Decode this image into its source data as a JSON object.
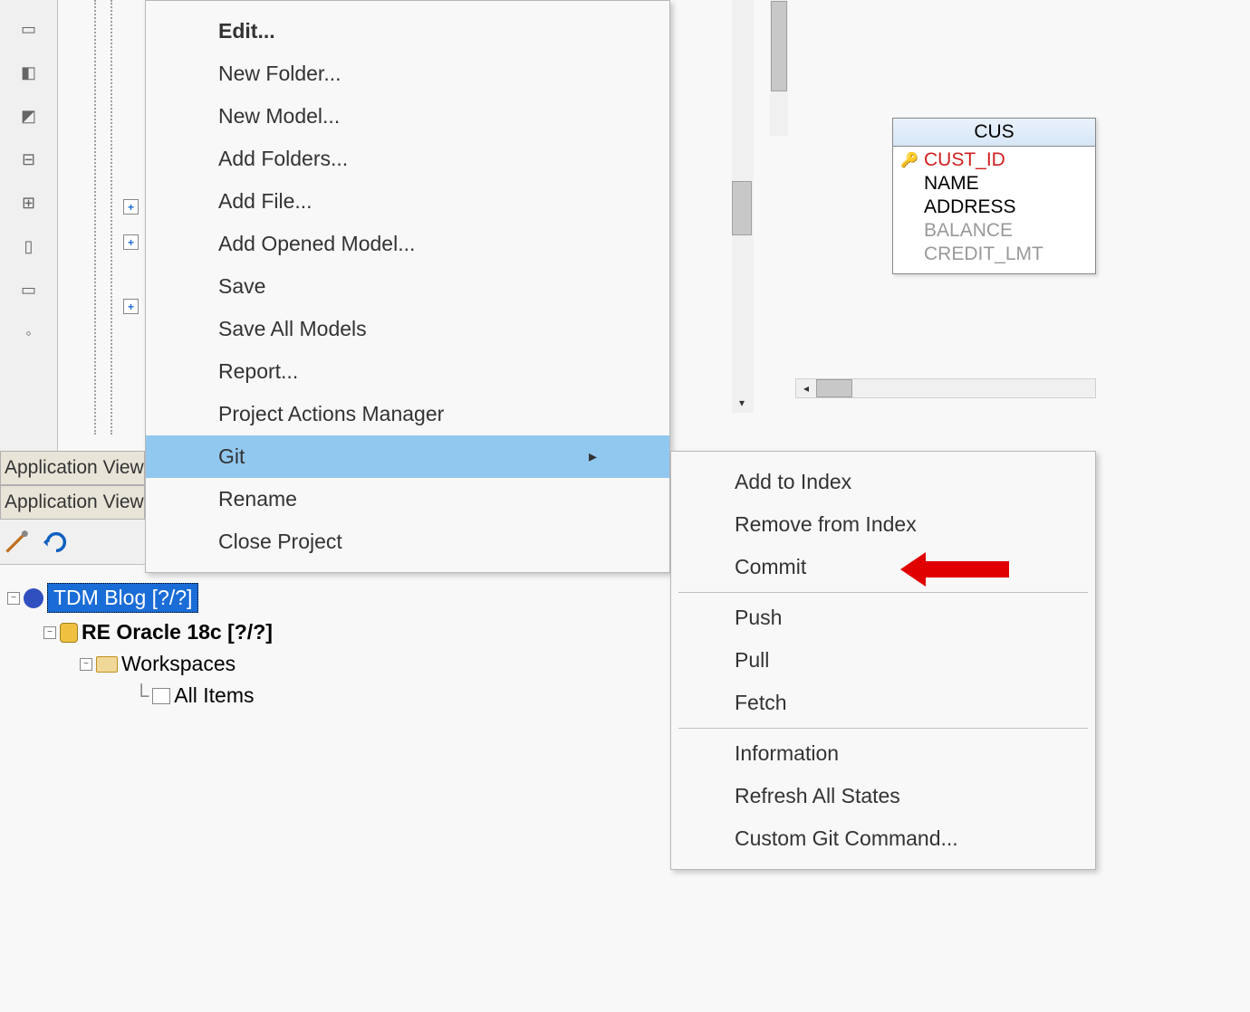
{
  "context_menu": {
    "items": [
      {
        "label": "Edit...",
        "bold": true
      },
      {
        "label": "New Folder..."
      },
      {
        "label": "New Model..."
      },
      {
        "label": "Add Folders..."
      },
      {
        "label": "Add File..."
      },
      {
        "label": "Add Opened Model..."
      },
      {
        "label": "Save"
      },
      {
        "label": "Save All Models"
      },
      {
        "label": "Report..."
      },
      {
        "label": "Project Actions Manager"
      },
      {
        "label": "Git",
        "submenu": true,
        "highlighted": true
      },
      {
        "label": "Rename"
      },
      {
        "label": "Close Project"
      }
    ]
  },
  "git_submenu": {
    "groups": [
      [
        "Add to Index",
        "Remove from Index",
        "Commit"
      ],
      [
        "Push",
        "Pull",
        "Fetch"
      ],
      [
        "Information",
        "Refresh All States",
        "Custom Git Command..."
      ]
    ]
  },
  "app_view": {
    "label": "Application View"
  },
  "tree": {
    "items": [
      {
        "label": "TDM Blog [?/?]",
        "level": 0,
        "selected": true,
        "icon": "blue-icon"
      },
      {
        "label": "RE Oracle 18c [?/?]",
        "level": 1,
        "bold": true,
        "icon": "db-icon"
      },
      {
        "label": "Workspaces",
        "level": 2,
        "icon": "workspace-icon"
      },
      {
        "label": "All Items",
        "level": 3,
        "icon": "items-icon"
      }
    ]
  },
  "entity": {
    "header": "CUS",
    "fields": [
      {
        "name": "CUST_ID",
        "key": true
      },
      {
        "name": "NAME"
      },
      {
        "name": "ADDRESS"
      },
      {
        "name": "BALANCE",
        "dimmed": true
      },
      {
        "name": "CREDIT_LMT",
        "dimmed": true
      }
    ]
  }
}
